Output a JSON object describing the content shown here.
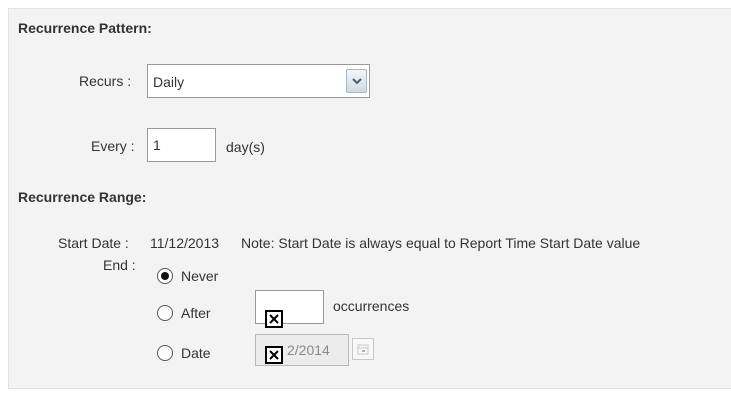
{
  "recurrence_pattern": {
    "title": "Recurrence Pattern:",
    "recurs_label": "Recurs :",
    "recurs_value": "Daily",
    "every_label": "Every :",
    "every_value": "1",
    "every_unit": "day(s)"
  },
  "recurrence_range": {
    "title": "Recurrence Range:",
    "start_date_label": "Start Date :",
    "start_date_value": "11/12/2013",
    "note": "Note: Start Date is always equal to Report Time Start Date value",
    "end_label": "End :",
    "options": {
      "never": "Never",
      "after": "After",
      "date": "Date"
    },
    "selected": "never",
    "occurrences_label": "occurrences",
    "date_field_visible_text": "2/2014"
  },
  "icons": {
    "dropdown": "chevron-down-icon",
    "broken_image": "broken-image-icon",
    "calendar": "calendar-icon"
  }
}
